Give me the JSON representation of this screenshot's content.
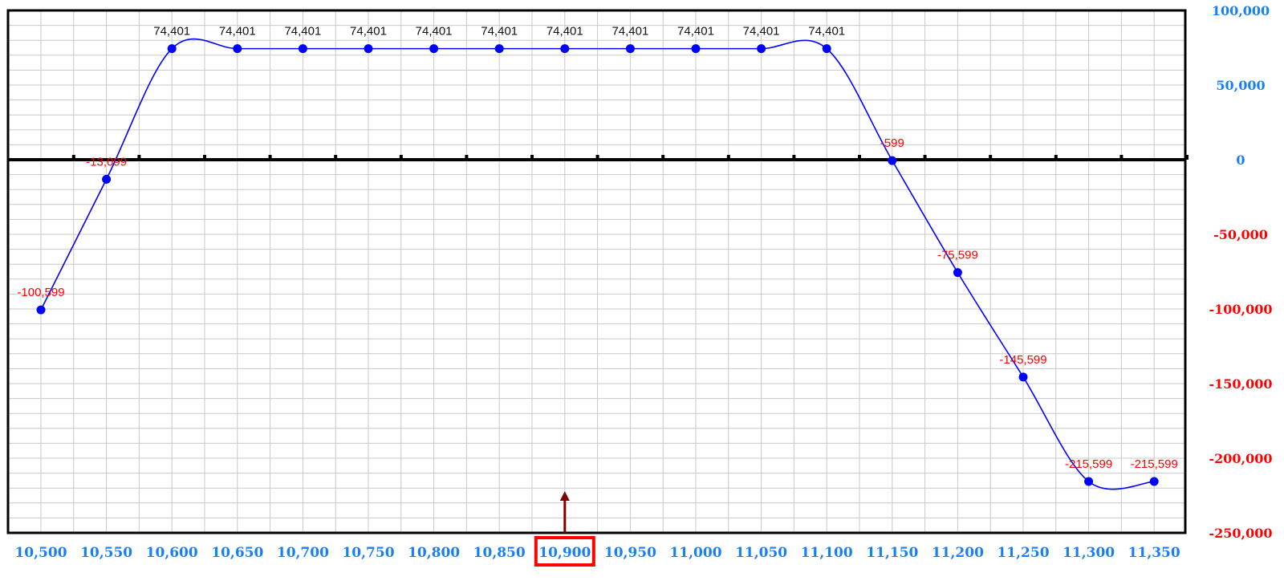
{
  "chart_data": {
    "type": "line",
    "x": [
      10500,
      10550,
      10600,
      10650,
      10700,
      10750,
      10800,
      10850,
      10900,
      10950,
      11000,
      11050,
      11100,
      11150,
      11200,
      11250,
      11300,
      11350
    ],
    "x_tick_labels": [
      "10,500",
      "10,550",
      "10,600",
      "10,650",
      "10,700",
      "10,750",
      "10,800",
      "10,850",
      "10,900",
      "10,950",
      "11,000",
      "11,050",
      "11,100",
      "11,150",
      "11,200",
      "11,250",
      "11,300",
      "11,350"
    ],
    "series": [
      {
        "values": [
          -100599,
          -13099,
          74401,
          74401,
          74401,
          74401,
          74401,
          74401,
          74401,
          74401,
          74401,
          74401,
          74401,
          -599,
          -75599,
          -145599,
          -215599,
          -215599
        ],
        "labels": [
          "-100,599",
          "-13,099",
          "74,401",
          "74,401",
          "74,401",
          "74,401",
          "74,401",
          "74,401",
          "74,401",
          "74,401",
          "74,401",
          "74,401",
          "74,401",
          "-599",
          "-75,599",
          "-145,599",
          "-215,599",
          "-215,599"
        ],
        "color": "#0000ff"
      }
    ],
    "y_ticks": [
      100000,
      50000,
      0,
      -50000,
      -100000,
      -150000,
      -200000,
      -250000
    ],
    "y_tick_labels": [
      "100,000",
      "50,000",
      "0",
      "-50,000",
      "-100,000",
      "-150,000",
      "-200,000",
      "-250,000"
    ],
    "ylim": [
      -250000,
      100000
    ],
    "xlim": [
      10475,
      11375
    ],
    "highlight_x": 10900,
    "highlight_label": "10,900",
    "grid": true,
    "colors": {
      "line": "#0000ff",
      "positive_label": "#111111",
      "negative_label": "#ff0000",
      "axis_tick_positive": "#1a7ff0",
      "axis_tick_negative": "#ff0000",
      "highlight_box": "#ff0000",
      "arrow": "#800000",
      "grid": "#c8c8c8"
    }
  }
}
